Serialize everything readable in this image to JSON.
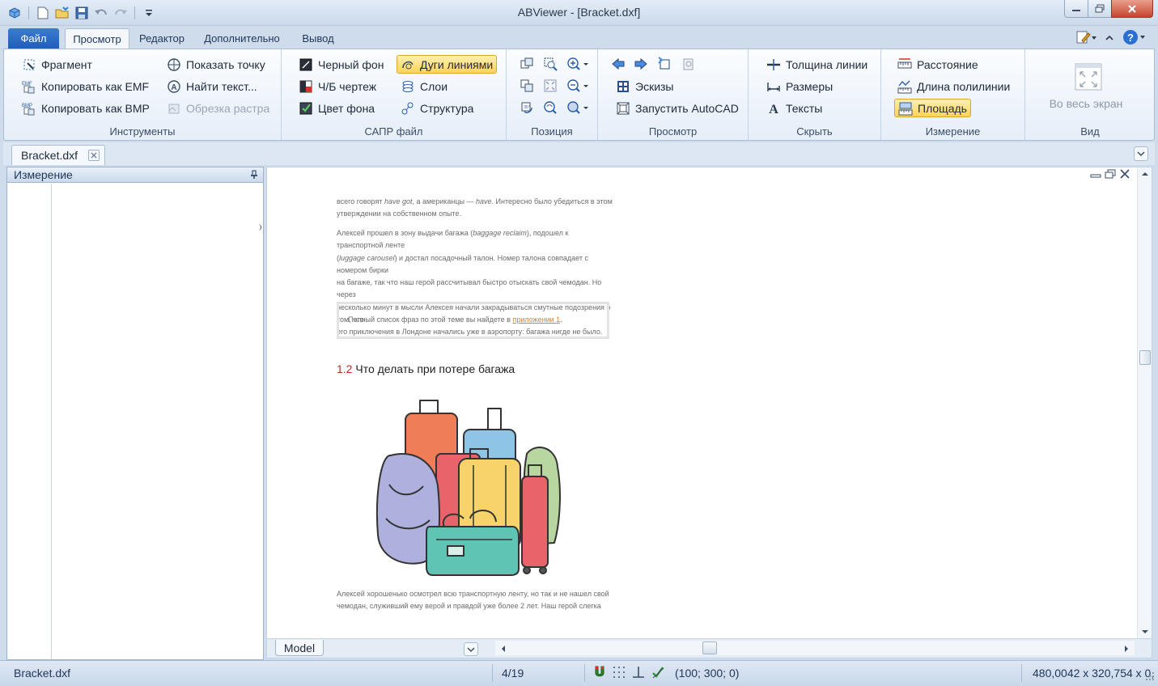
{
  "window": {
    "title": "ABViewer - [Bracket.dxf]"
  },
  "quick_access": {
    "icons": [
      "app-icon",
      "new-icon",
      "open-icon",
      "save-icon",
      "undo-icon",
      "redo-icon",
      "customize-icon"
    ]
  },
  "tabs": {
    "file": "Файл",
    "items": [
      {
        "label": "Просмотр",
        "active": true
      },
      {
        "label": "Редактор",
        "active": false
      },
      {
        "label": "Дополнительно",
        "active": false
      },
      {
        "label": "Вывод",
        "active": false
      }
    ]
  },
  "ribbon": {
    "tools": {
      "label": "Инструменты",
      "fragment": "Фрагмент",
      "copy_emf": "Копировать как EMF",
      "copy_bmp": "Копировать как BMP",
      "show_point": "Показать точку",
      "find_text": "Найти текст...",
      "crop_raster": "Обрезка растра"
    },
    "cad_file": {
      "label": "САПР файл",
      "black_bg": "Черный фон",
      "bw_drawing": "Ч/Б чертеж",
      "bg_color": "Цвет фона",
      "arcs_lines": "Дуги линиями",
      "layers": "Слои",
      "structure": "Структура"
    },
    "position": {
      "label": "Позиция"
    },
    "view": {
      "label": "Просмотр",
      "thumbnails": "Эскизы",
      "run_autocad": "Запустить AutoCAD"
    },
    "hide": {
      "label": "Скрыть",
      "line_weight": "Толщина линии",
      "dimensions": "Размеры",
      "texts": "Тексты"
    },
    "measure": {
      "label": "Измерение",
      "distance": "Расстояние",
      "polyline_length": "Длина полилинии",
      "area": "Площадь"
    },
    "viewmode": {
      "label": "Вид",
      "fullscreen": "Во весь экран"
    }
  },
  "document_tab": {
    "name": "Bracket.dxf"
  },
  "left_panel": {
    "title": "Измерение"
  },
  "content": {
    "p1_line1_a": "всего говорят ",
    "p1_line1_i1": "have got",
    "p1_line1_b": ", а американцы — ",
    "p1_line1_i2": "have",
    "p1_line1_c": ". Интересно было убедиться в этом",
    "p1_line2": "утверждении на собственном опыте.",
    "p2_line1_a": "Алексей прошел в зону выдачи багажа (",
    "p2_line1_i": "baggage reclaim",
    "p2_line1_b": "), подошел к транспортной ленте",
    "p2_line2_a": "(",
    "p2_line2_i": "luggage carousel",
    "p2_line2_b": ") и достал посадочный талон. Номер талона совпадает с номером бирки",
    "p2_line3": "на багаже, так что наш герой рассчитывал быстро отыскать свой чемодан. Но через",
    "p2_line4": "несколько минут в мысли Алексея начали закрадываться смутные подозрения о том, что",
    "p2_line5": "его приключения в Лондоне начались уже в аэропорту: багажа нигде не было.",
    "callout_text": "Полный список фраз по этой теме вы найдете в ",
    "callout_link": "приложении 1",
    "callout_end": ".",
    "heading_num": "1.2",
    "heading_text": " Что делать при потере багажа",
    "p3_line1": "Алексей хорошенько осмотрел всю транспортную ленту, но так и не нашел свой",
    "p3_line2": "чемодан, служивший ему верой и правдой уже более 2 лет. Наш герой слегка"
  },
  "layout_tab": {
    "name": "Model"
  },
  "status": {
    "file": "Bracket.dxf",
    "page": "4/19",
    "coords": "(100; 300; 0)",
    "size": "480,0042 x 320,754 x 0,"
  },
  "colors": {
    "accent": "#1f5fb8",
    "highlight": "#ffd456",
    "heading_number": "#c62828",
    "link": "#d0823c"
  }
}
